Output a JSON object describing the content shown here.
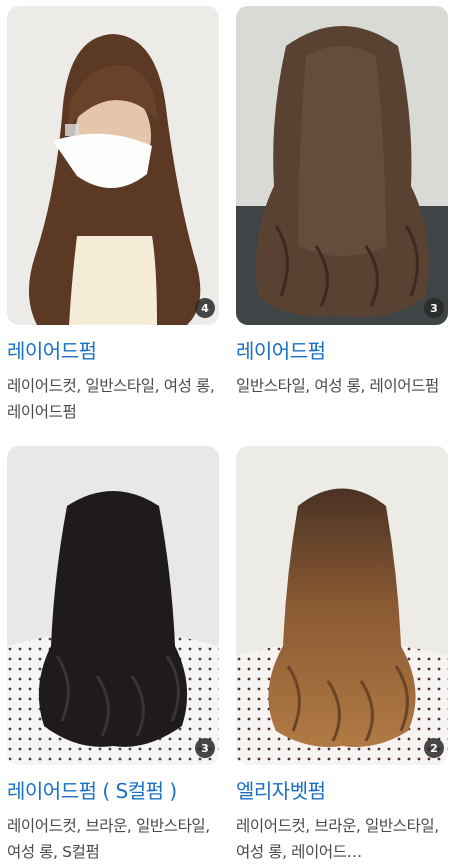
{
  "cards": [
    {
      "title": "레이어드펌",
      "tags": "레이어드컷, 일반스타일, 여성 롱, 레이어드펌",
      "count": "4"
    },
    {
      "title": "레이어드펌",
      "tags": "일반스타일, 여성 롱, 레이어드펌",
      "count": "3"
    },
    {
      "title": "레이어드펌 ( S컬펌 )",
      "tags": "레이어드컷, 브라운, 일반스타일, 여성 롱, S컬펌",
      "count": "3"
    },
    {
      "title": "엘리자벳펌",
      "tags": "레이어드컷, 브라운, 일반스타일, 여성 롱, 레이어드…",
      "count": "2"
    }
  ],
  "colors": {
    "title": "#1a6fc9",
    "tags": "#4a4a4a",
    "badge": "#282828"
  },
  "icons": [
    "photo-count-badge"
  ]
}
